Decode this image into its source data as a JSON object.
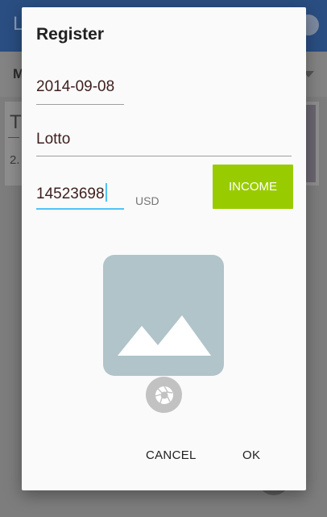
{
  "background": {
    "appbar_title": "L",
    "toolbar_label": "M",
    "card_title": "T",
    "card_subtitle": "2."
  },
  "dialog": {
    "title": "Register",
    "date_value": "2014-09-08",
    "name_value": "Lotto",
    "amount_value": "14523698",
    "currency": "USD",
    "income_label": "INCOME",
    "cancel_label": "CANCEL",
    "ok_label": "OK"
  },
  "icons": {
    "image_placeholder": "image-icon",
    "camera": "camera-shutter-icon",
    "settings": "gear-icon"
  },
  "colors": {
    "income_button": "#99cc00",
    "focus_accent": "#4fc3f7",
    "placeholder": "#b0c4ca"
  }
}
